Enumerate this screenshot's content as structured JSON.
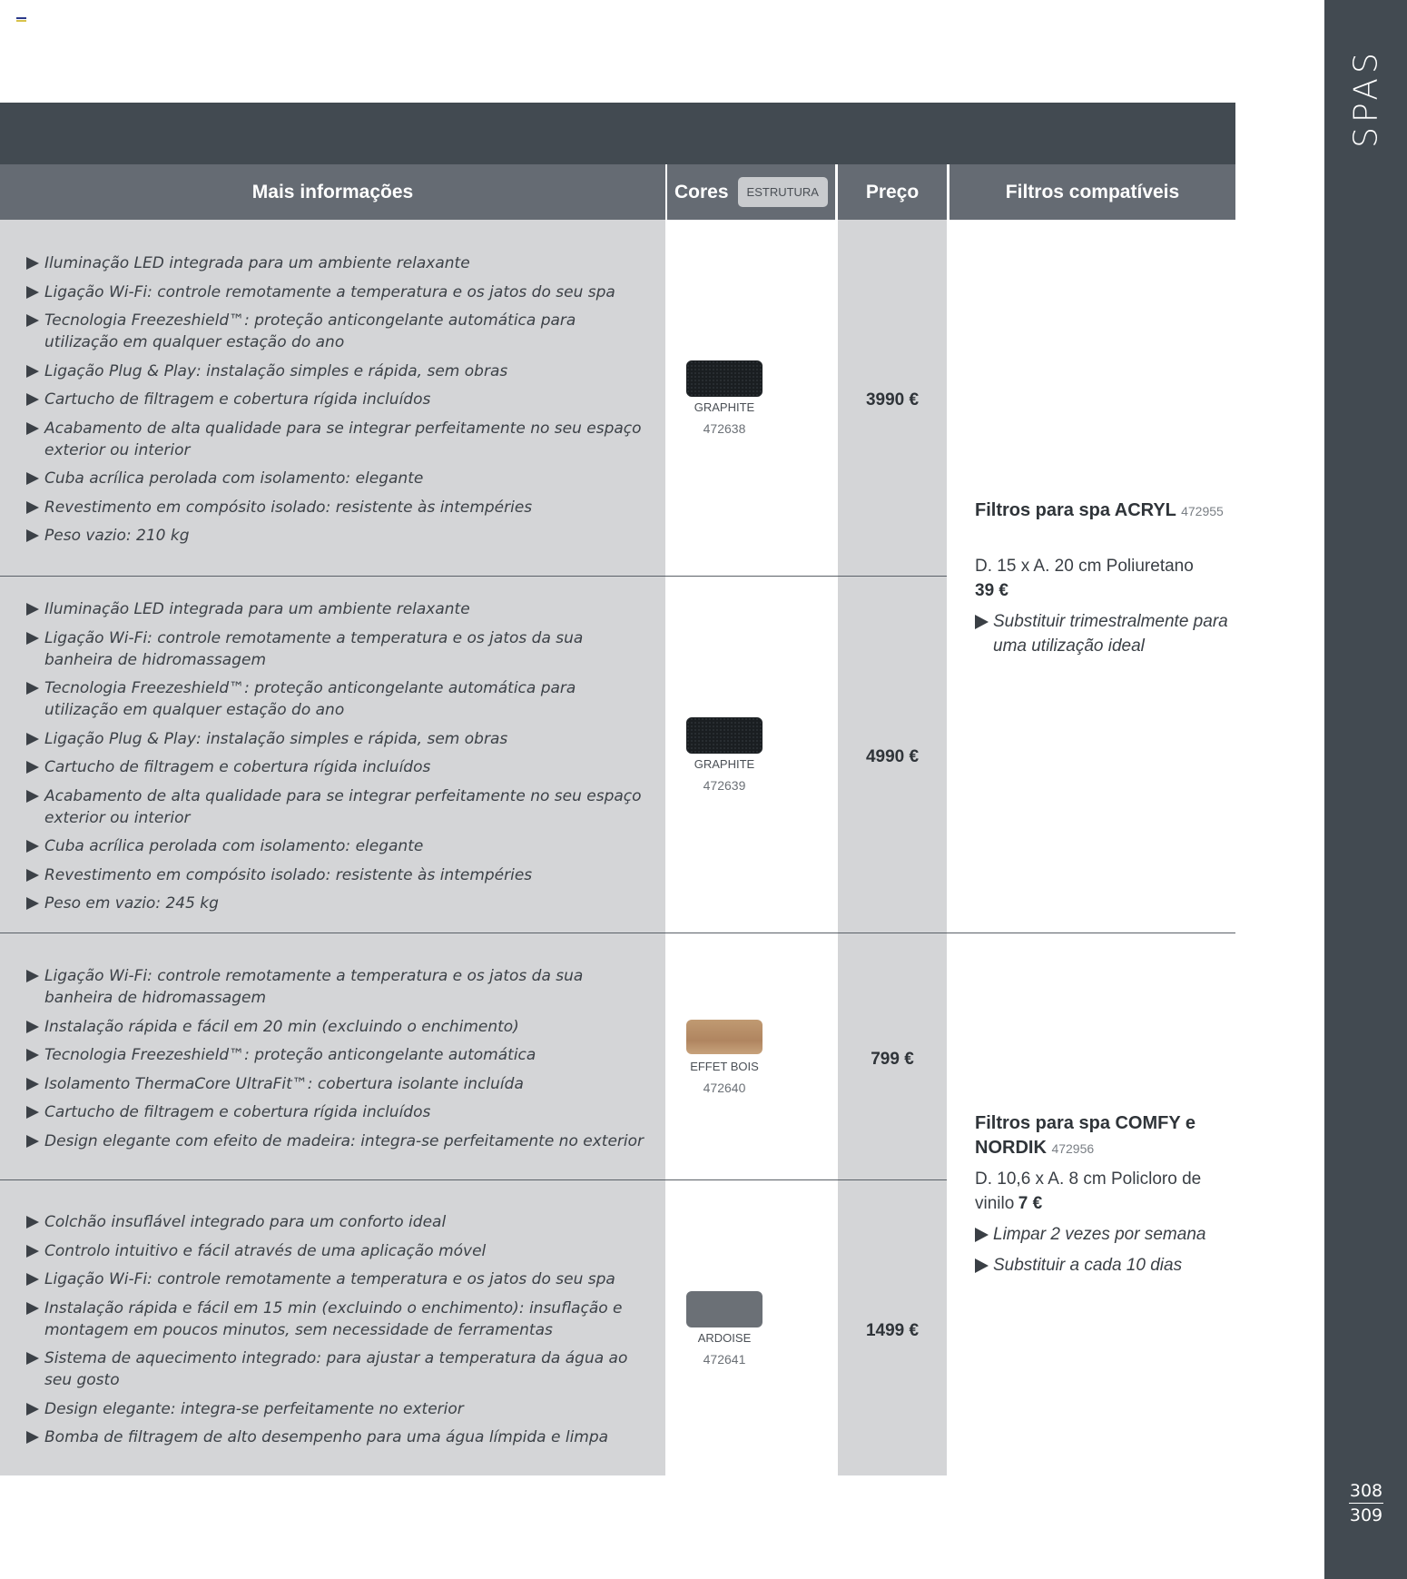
{
  "side": {
    "title": "SPAS",
    "page_left": "308",
    "page_right": "309"
  },
  "headers": {
    "info": "Mais informações",
    "cores": "Cores",
    "estrutura": "ESTRUTURA",
    "preco": "Preço",
    "filtros": "Filtros compatíveis"
  },
  "colors": {
    "graphite": "#1a1e21",
    "effet_bois": "#b8916a",
    "ardoise": "#6b7076",
    "dark_band": "#424a51",
    "header_grey": "#656b73",
    "column_grey": "#d4d5d7"
  },
  "products": [
    {
      "features": [
        "Iluminação LED integrada para um ambiente relaxante",
        "Ligação Wi-Fi: controle remotamente a temperatura e os jatos do seu spa",
        "Tecnologia Freezeshield™: proteção anticongelante automática para utilização em qualquer estação do ano",
        "Ligação Plug & Play: instalação simples e rápida, sem obras",
        "Cartucho de filtragem e cobertura rígida incluídos",
        "Acabamento de alta qualidade para se integrar perfeitamente no seu espaço exterior ou interior",
        "Cuba acrílica perolada com isolamento: elegante",
        "Revestimento em compósito isolado: resistente às intempéries",
        "Peso vazio: 210 kg"
      ],
      "color_name": "GRAPHITE",
      "ref": "472638",
      "price": "3990 €"
    },
    {
      "features": [
        "Iluminação LED integrada para um ambiente relaxante",
        "Ligação Wi-Fi: controle remotamente a temperatura e os jatos da sua banheira de hidromassagem",
        "Tecnologia Freezeshield™: proteção anticongelante automática para utilização em qualquer estação do ano",
        "Ligação Plug & Play: instalação simples e rápida, sem obras",
        "Cartucho de filtragem e cobertura rígida incluídos",
        "Acabamento de alta qualidade para se integrar perfeitamente no seu espaço exterior ou interior",
        "Cuba acrílica perolada com isolamento: elegante",
        "Revestimento em compósito isolado: resistente às intempéries",
        "Peso em vazio: 245 kg"
      ],
      "color_name": "GRAPHITE",
      "ref": "472639",
      "price": "4990 €"
    },
    {
      "features": [
        "Ligação Wi-Fi: controle remotamente a temperatura e os jatos da sua banheira de hidromassagem",
        "Instalação rápida e fácil em 20 min (excluindo o enchimento)",
        "Tecnologia Freezeshield™: proteção anticongelante automática",
        "Isolamento ThermaCore UltraFit™: cobertura isolante incluída",
        "Cartucho de filtragem e cobertura rígida incluídos",
        "Design elegante com efeito de madeira: integra-se perfeitamente no exterior"
      ],
      "color_name": "EFFET BOIS",
      "ref": "472640",
      "price": "799 €"
    },
    {
      "features": [
        "Colchão insuflável integrado para um conforto ideal",
        "Controlo intuitivo e fácil através de uma aplicação móvel",
        "Ligação Wi-Fi: controle remotamente a temperatura e os jatos do seu spa",
        "Instalação rápida e fácil em 15 min (excluindo o enchimento): insuflação e montagem em poucos minutos, sem necessidade de ferramentas",
        "Sistema de aquecimento integrado: para ajustar a temperatura da água ao seu gosto",
        "Design elegante: integra-se perfeitamente no exterior",
        "Bomba de filtragem de alto desempenho para uma água límpida e limpa"
      ],
      "color_name": "ARDOISE",
      "ref": "472641",
      "price": "1499 €"
    }
  ],
  "filters": [
    {
      "title": "Filtros para spa ACRYL",
      "ref": "472955",
      "dims": "D. 15 x A. 20 cm Poliuretano",
      "price": "39 €",
      "tips": [
        "Substituir trimestralmente para uma utilização ideal"
      ]
    },
    {
      "title": "Filtros para spa COMFY e NORDIK",
      "ref": "472956",
      "dims": "D. 10,6 x A. 8 cm Policloro de vinilo",
      "price": "7 €",
      "tips": [
        "Limpar 2 vezes por semana",
        "Substituir a cada 10 dias"
      ]
    }
  ]
}
